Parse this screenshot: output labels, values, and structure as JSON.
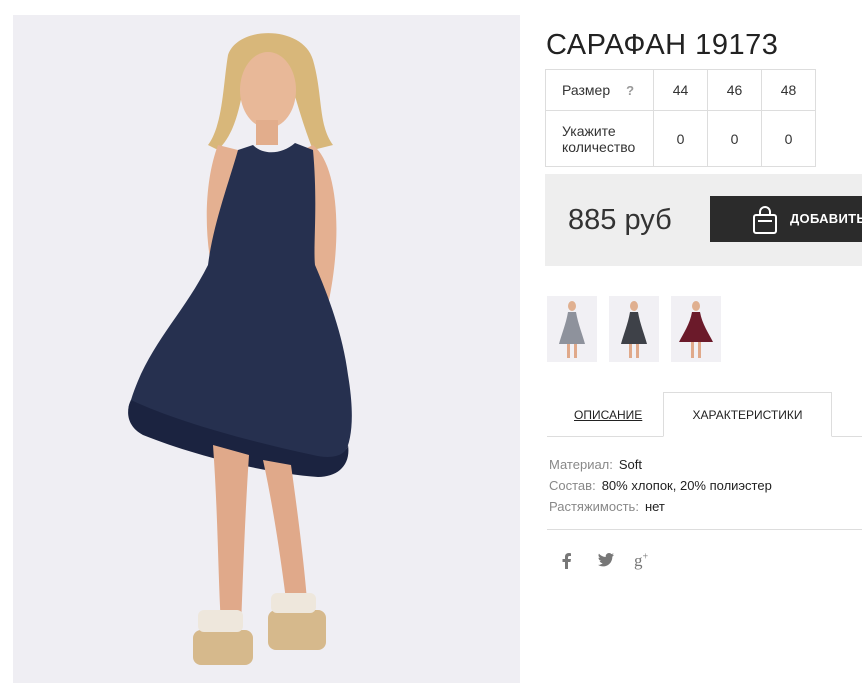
{
  "product": {
    "title": "САРАФАН 19173",
    "photo_icon": "product-photo-woman-in-navy-dress"
  },
  "sizes": {
    "size_label": "Размер",
    "help_mark": "?",
    "size_values": [
      "44",
      "46",
      "48"
    ],
    "qty_label": "Укажите количество",
    "qty_values": [
      "0",
      "0",
      "0"
    ]
  },
  "purchase": {
    "price": "885 руб",
    "add_label": "ДОБАВИТЬ",
    "add_icon": "shopping-bag-icon"
  },
  "thumbnails": [
    {
      "name": "grey-dress-thumbnail",
      "color": "#8e929c"
    },
    {
      "name": "dark-grey-dress-thumbnail",
      "color": "#3e4148"
    },
    {
      "name": "burgundy-dress-thumbnail",
      "color": "#6b1a2a"
    }
  ],
  "tabs": {
    "description": "ОПИСАНИЕ",
    "characteristics": "ХАРАКТЕРИСТИКИ"
  },
  "properties": [
    {
      "key": "Материал:",
      "value": "Soft"
    },
    {
      "key": "Состав:",
      "value": "80% хлопок, 20% полиэстер"
    },
    {
      "key": "Растяжимость:",
      "value": "нет"
    }
  ],
  "social": [
    {
      "name": "facebook-icon",
      "glyph": "f"
    },
    {
      "name": "twitter-icon",
      "glyph": "t"
    },
    {
      "name": "google-plus-icon",
      "glyph": "g+"
    }
  ],
  "colors": {
    "dress": "#26304f",
    "button": "#2b2b2b",
    "price_bg": "#eeeeee"
  }
}
